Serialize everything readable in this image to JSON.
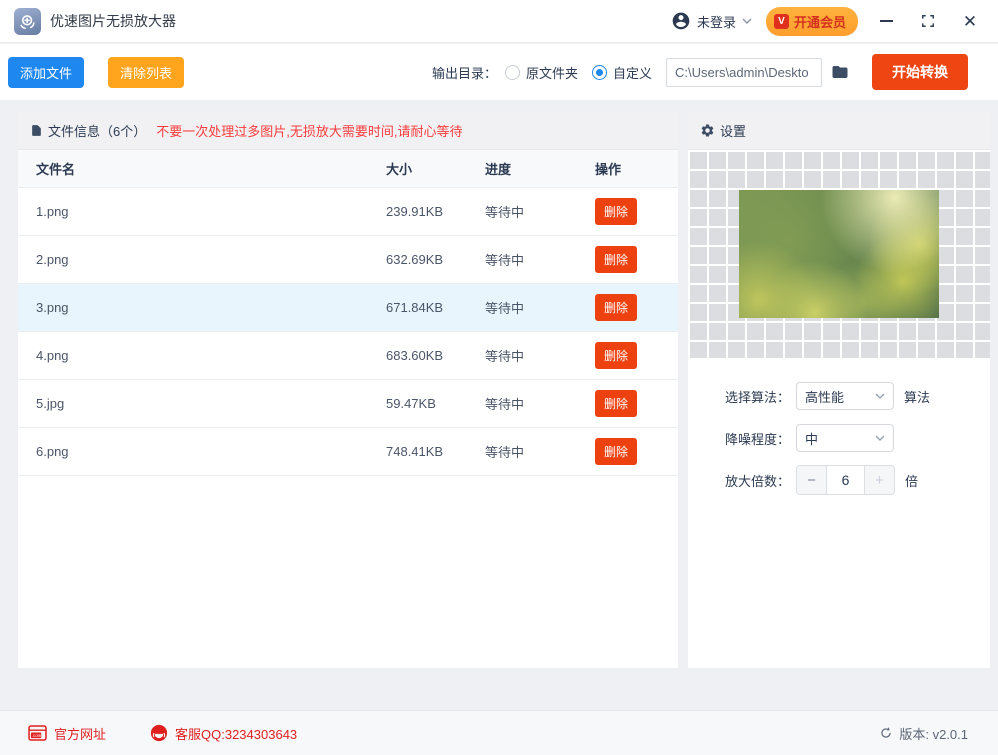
{
  "titlebar": {
    "app_title": "优速图片无损放大器",
    "login_label": "未登录",
    "vip_badge": "V",
    "vip_label": "开通会员"
  },
  "toolbar": {
    "add_files": "添加文件",
    "clear_list": "清除列表",
    "output_dir_label": "输出目录：",
    "radio_original": "原文件夹",
    "radio_custom": "自定义",
    "output_path": "C:\\Users\\admin\\Deskto",
    "start_button": "开始转换"
  },
  "file_panel": {
    "header_title": "文件信息（6个）",
    "header_warning": "不要一次处理过多图片,无损放大需要时间,请耐心等待",
    "col_name": "文件名",
    "col_size": "大小",
    "col_status": "进度",
    "col_action": "操作",
    "delete_label": "删除",
    "rows": [
      {
        "name": "1.png",
        "size": "239.91KB",
        "status": "等待中"
      },
      {
        "name": "2.png",
        "size": "632.69KB",
        "status": "等待中"
      },
      {
        "name": "3.png",
        "size": "671.84KB",
        "status": "等待中"
      },
      {
        "name": "4.png",
        "size": "683.60KB",
        "status": "等待中"
      },
      {
        "name": "5.jpg",
        "size": "59.47KB",
        "status": "等待中"
      },
      {
        "name": "6.png",
        "size": "748.41KB",
        "status": "等待中"
      }
    ]
  },
  "settings_panel": {
    "header": "设置",
    "algorithm_label": "选择算法：",
    "algorithm_value": "高性能",
    "algorithm_suffix": "算法",
    "denoise_label": "降噪程度：",
    "denoise_value": "中",
    "scale_label": "放大倍数：",
    "scale_minus": "−",
    "scale_value": "6",
    "scale_plus": "+",
    "scale_suffix": "倍"
  },
  "footer": {
    "website_label": "官方网址",
    "qq_label": "客服QQ:3234303643",
    "version_label": "版本: v2.0.1"
  },
  "colors": {
    "accent_blue": "#1e87f0",
    "accent_orange": "#ffa41d",
    "accent_red_orange": "#ee4512",
    "warning_red": "#f83b3b",
    "footer_red": "#e01f1f",
    "selected_row": "#e9f5fd",
    "dark_navy_text": "#2b3a52"
  }
}
